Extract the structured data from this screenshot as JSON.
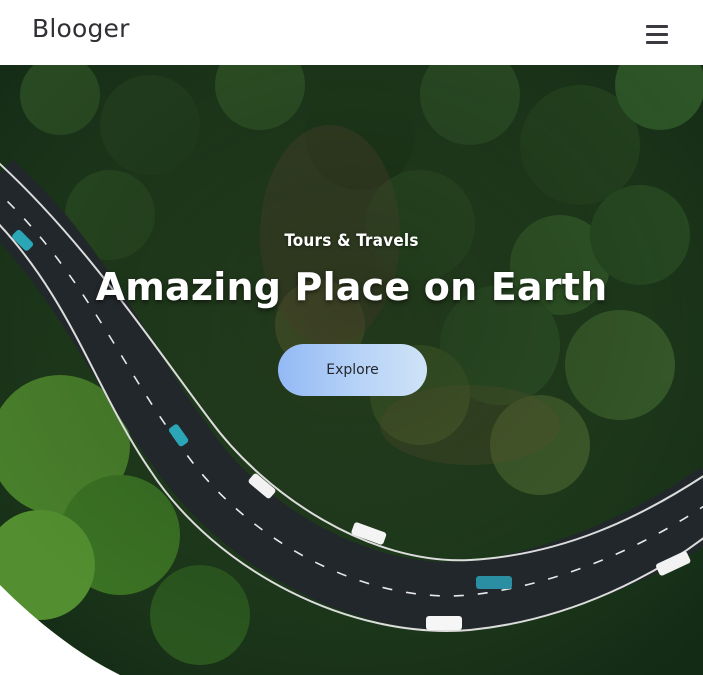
{
  "navbar": {
    "brand": "Blooger",
    "menu_icon": "hamburger-menu-icon"
  },
  "hero": {
    "subtitle": "Tours & Travels",
    "title": "Amazing Place on Earth",
    "cta_label": "Explore",
    "background_image": "aerial view of a winding road through a forest",
    "colors": {
      "cta_gradient_start": "#93b9f6",
      "cta_gradient_end": "#cfe3f7",
      "forest": "#1f3a1c",
      "road": "#22272b"
    }
  }
}
